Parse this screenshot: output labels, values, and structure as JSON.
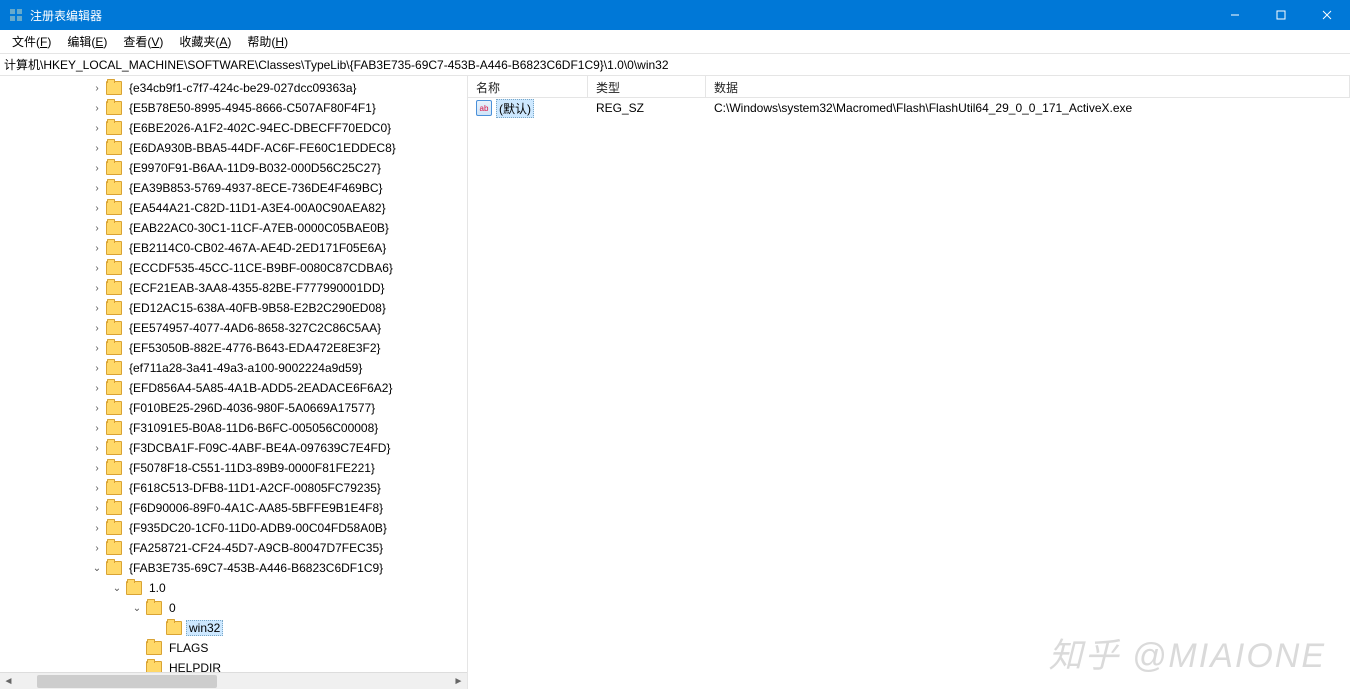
{
  "window": {
    "title": "注册表编辑器"
  },
  "menubar": {
    "items": [
      {
        "label": "文件",
        "accel": "F"
      },
      {
        "label": "编辑",
        "accel": "E"
      },
      {
        "label": "查看",
        "accel": "V"
      },
      {
        "label": "收藏夹",
        "accel": "A"
      },
      {
        "label": "帮助",
        "accel": "H"
      }
    ]
  },
  "addressbar": {
    "path": "计算机\\HKEY_LOCAL_MACHINE\\SOFTWARE\\Classes\\TypeLib\\{FAB3E735-69C7-453B-A446-B6823C6DF1C9}\\1.0\\0\\win32"
  },
  "tree": {
    "base_indent": 90,
    "items": [
      {
        "label": "{e34cb9f1-c7f7-424c-be29-027dcc09363a}",
        "indent": 90,
        "exp": "closed"
      },
      {
        "label": "{E5B78E50-8995-4945-8666-C507AF80F4F1}",
        "indent": 90,
        "exp": "closed"
      },
      {
        "label": "{E6BE2026-A1F2-402C-94EC-DBECFF70EDC0}",
        "indent": 90,
        "exp": "closed"
      },
      {
        "label": "{E6DA930B-BBA5-44DF-AC6F-FE60C1EDDEC8}",
        "indent": 90,
        "exp": "closed"
      },
      {
        "label": "{E9970F91-B6AA-11D9-B032-000D56C25C27}",
        "indent": 90,
        "exp": "closed"
      },
      {
        "label": "{EA39B853-5769-4937-8ECE-736DE4F469BC}",
        "indent": 90,
        "exp": "closed"
      },
      {
        "label": "{EA544A21-C82D-11D1-A3E4-00A0C90AEA82}",
        "indent": 90,
        "exp": "closed"
      },
      {
        "label": "{EAB22AC0-30C1-11CF-A7EB-0000C05BAE0B}",
        "indent": 90,
        "exp": "closed"
      },
      {
        "label": "{EB2114C0-CB02-467A-AE4D-2ED171F05E6A}",
        "indent": 90,
        "exp": "closed"
      },
      {
        "label": "{ECCDF535-45CC-11CE-B9BF-0080C87CDBA6}",
        "indent": 90,
        "exp": "closed"
      },
      {
        "label": "{ECF21EAB-3AA8-4355-82BE-F777990001DD}",
        "indent": 90,
        "exp": "closed"
      },
      {
        "label": "{ED12AC15-638A-40FB-9B58-E2B2C290ED08}",
        "indent": 90,
        "exp": "closed"
      },
      {
        "label": "{EE574957-4077-4AD6-8658-327C2C86C5AA}",
        "indent": 90,
        "exp": "closed"
      },
      {
        "label": "{EF53050B-882E-4776-B643-EDA472E8E3F2}",
        "indent": 90,
        "exp": "closed"
      },
      {
        "label": "{ef711a28-3a41-49a3-a100-9002224a9d59}",
        "indent": 90,
        "exp": "closed"
      },
      {
        "label": "{EFD856A4-5A85-4A1B-ADD5-2EADACE6F6A2}",
        "indent": 90,
        "exp": "closed"
      },
      {
        "label": "{F010BE25-296D-4036-980F-5A0669A17577}",
        "indent": 90,
        "exp": "closed"
      },
      {
        "label": "{F31091E5-B0A8-11D6-B6FC-005056C00008}",
        "indent": 90,
        "exp": "closed"
      },
      {
        "label": "{F3DCBA1F-F09C-4ABF-BE4A-097639C7E4FD}",
        "indent": 90,
        "exp": "closed"
      },
      {
        "label": "{F5078F18-C551-11D3-89B9-0000F81FE221}",
        "indent": 90,
        "exp": "closed"
      },
      {
        "label": "{F618C513-DFB8-11D1-A2CF-00805FC79235}",
        "indent": 90,
        "exp": "closed"
      },
      {
        "label": "{F6D90006-89F0-4A1C-AA85-5BFFE9B1E4F8}",
        "indent": 90,
        "exp": "closed"
      },
      {
        "label": "{F935DC20-1CF0-11D0-ADB9-00C04FD58A0B}",
        "indent": 90,
        "exp": "closed"
      },
      {
        "label": "{FA258721-CF24-45D7-A9CB-80047D7FEC35}",
        "indent": 90,
        "exp": "closed"
      },
      {
        "label": "{FAB3E735-69C7-453B-A446-B6823C6DF1C9}",
        "indent": 90,
        "exp": "open"
      },
      {
        "label": "1.0",
        "indent": 110,
        "exp": "open"
      },
      {
        "label": "0",
        "indent": 130,
        "exp": "open"
      },
      {
        "label": "win32",
        "indent": 150,
        "exp": "none",
        "selected": true
      },
      {
        "label": "FLAGS",
        "indent": 130,
        "exp": "none"
      },
      {
        "label": "HELPDIR",
        "indent": 130,
        "exp": "none"
      }
    ]
  },
  "list": {
    "headers": {
      "name": "名称",
      "type": "类型",
      "data": "数据"
    },
    "rows": [
      {
        "name": "(默认)",
        "type": "REG_SZ",
        "data": "C:\\Windows\\system32\\Macromed\\Flash\\FlashUtil64_29_0_0_171_ActiveX.exe",
        "selected": true
      }
    ]
  },
  "watermark": "知乎 @MIAIONE"
}
